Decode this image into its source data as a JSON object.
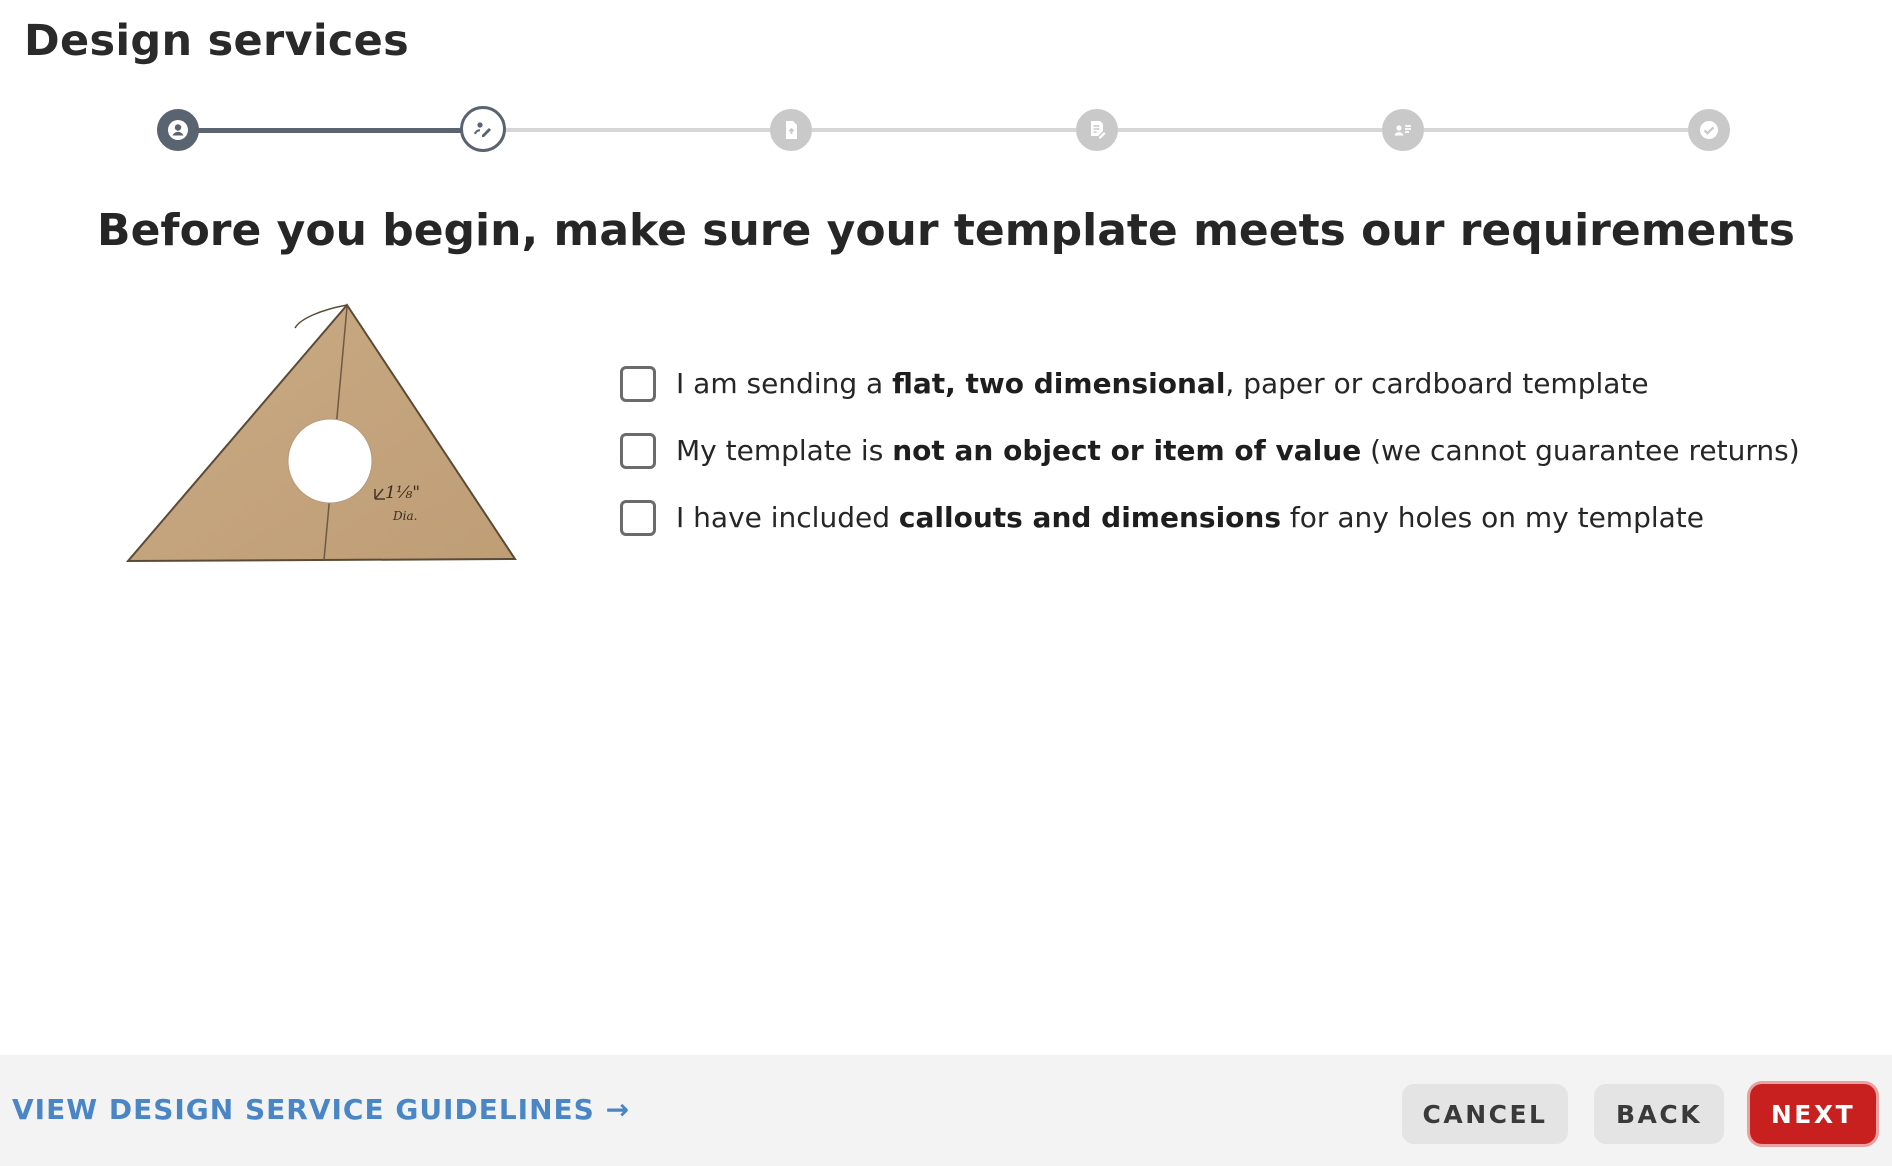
{
  "page": {
    "title": "Design services"
  },
  "stepper": {
    "steps": [
      {
        "icon": "user-icon",
        "state": "done"
      },
      {
        "icon": "design-pen-icon",
        "state": "current"
      },
      {
        "icon": "file-upload-icon",
        "state": "upcoming"
      },
      {
        "icon": "document-edit-icon",
        "state": "upcoming"
      },
      {
        "icon": "contact-card-icon",
        "state": "upcoming"
      },
      {
        "icon": "checkmark-icon",
        "state": "upcoming"
      }
    ],
    "colors": {
      "done": "#5a6370",
      "upcoming": "#c9c9c9"
    }
  },
  "main": {
    "heading": "Before you begin, make sure your template meets our requirements",
    "template_image": {
      "annotation_line1": "1⅛\"",
      "annotation_line2": "Dia."
    },
    "checklist": [
      {
        "before": "I am sending a ",
        "bold": "flat, two dimensional",
        "after": ", paper or cardboard template",
        "checked": false
      },
      {
        "before": "My template is ",
        "bold": "not an object or item of value",
        "after": " (we cannot guarantee returns)",
        "checked": false
      },
      {
        "before": "I have included ",
        "bold": "callouts and dimensions",
        "after": " for any holes on my template",
        "checked": false
      }
    ]
  },
  "footer": {
    "guidelines_link": "VIEW DESIGN SERVICE GUIDELINES →",
    "cancel_label": "CANCEL",
    "back_label": "BACK",
    "next_label": "NEXT",
    "colors": {
      "link": "#4a86c5",
      "primary": "#c8201f"
    }
  }
}
